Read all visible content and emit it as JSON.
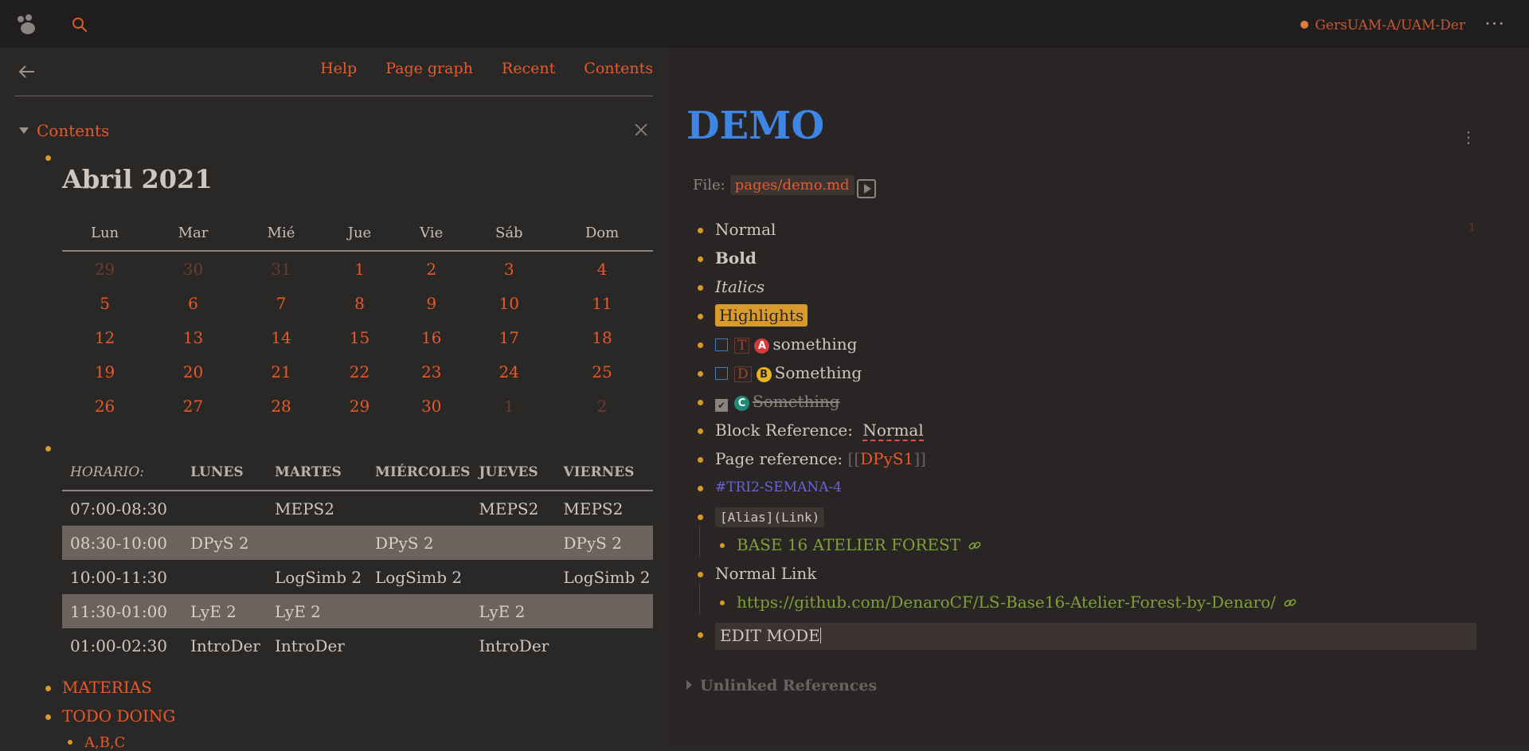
{
  "topbar": {
    "repo": "GersUAM-A/UAM-Der",
    "more": "···"
  },
  "sidebar": {
    "links": [
      "Help",
      "Page graph",
      "Recent",
      "Contents"
    ],
    "contents_title": "Contents",
    "calendar": {
      "title": "Abril 2021",
      "days": [
        "Lun",
        "Mar",
        "Mié",
        "Jue",
        "Vie",
        "Sáb",
        "Dom"
      ],
      "weeks": [
        [
          "29",
          "30",
          "31",
          "1",
          "2",
          "3",
          "4"
        ],
        [
          "5",
          "6",
          "7",
          "8",
          "9",
          "10",
          "11"
        ],
        [
          "12",
          "13",
          "14",
          "15",
          "16",
          "17",
          "18"
        ],
        [
          "19",
          "20",
          "21",
          "22",
          "23",
          "24",
          "25"
        ],
        [
          "26",
          "27",
          "28",
          "29",
          "30",
          "1",
          "2"
        ]
      ]
    },
    "schedule": {
      "headers": [
        "HORARIO:",
        "LUNES",
        "MARTES",
        "MIÉRCOLES",
        "JUEVES",
        "VIERNES"
      ],
      "rows": [
        [
          "07:00-08:30",
          "",
          "MEPS2",
          "",
          "MEPS2",
          "MEPS2"
        ],
        [
          "08:30-10:00",
          "DPyS 2",
          "",
          "DPyS 2",
          "",
          "DPyS 2"
        ],
        [
          "10:00-11:30",
          "",
          "LogSimb 2",
          "LogSimb 2",
          "",
          "LogSimb 2"
        ],
        [
          "11:30-01:00",
          "LyE 2",
          "LyE 2",
          "",
          "LyE 2",
          ""
        ],
        [
          "01:00-02:30",
          "IntroDer",
          "IntroDer",
          "",
          "IntroDer",
          ""
        ]
      ]
    },
    "items": [
      "MATERIAS",
      "TODO DOING",
      "A,B,C"
    ]
  },
  "page": {
    "title": "DEMO",
    "file_label": "File:",
    "file_path": "pages/demo.md",
    "ref_count": "1",
    "blocks": {
      "normal": "Normal",
      "bold": "Bold",
      "italics": "Italics",
      "highlights": "Highlights",
      "todo_marker": "T",
      "todo_priority": "A",
      "todo_text": "something",
      "doing_marker": "D",
      "doing_priority": "B",
      "doing_text": "Something",
      "done_priority": "C",
      "done_text": "Something",
      "block_ref_label": "Block Reference: ",
      "block_ref_value": "Normal",
      "page_ref_label": "Page reference: ",
      "page_ref_open": "[[",
      "page_ref_value": "DPyS1",
      "page_ref_close": "]]",
      "tag": "#TRI2-SEMANA-4",
      "alias_code": "[Alias](Link)",
      "alias_child": "BASE 16 ATELIER FOREST",
      "normal_link": "Normal Link",
      "link_child": "https://github.com/DenaroCF/LS-Base16-Atelier-Forest-by-Denaro/",
      "edit_mode": "EDIT MODE"
    },
    "unlinked": "Unlinked References"
  },
  "colors": {
    "accent": "#e8592a",
    "bullet": "#d99a2b",
    "title_blue": "#3f86e4",
    "priority_a": "#d8393a",
    "priority_b": "#e8b424",
    "priority_c": "#1f8a78"
  }
}
